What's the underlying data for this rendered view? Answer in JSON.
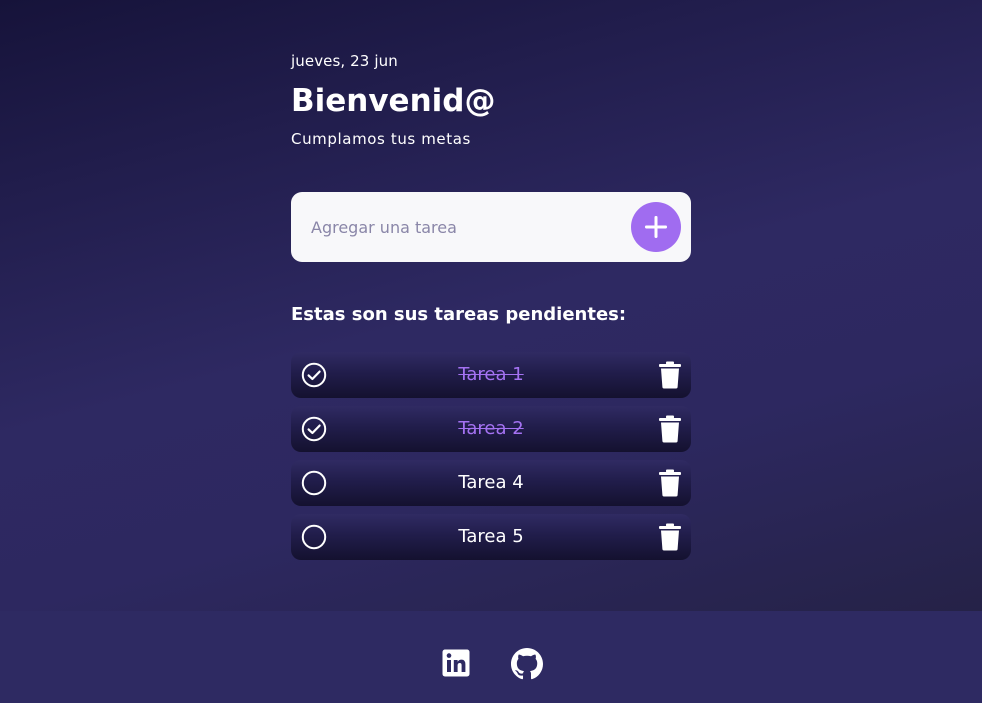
{
  "header": {
    "date": "jueves, 23 jun",
    "title": "Bienvenid@",
    "subtitle": "Cumplamos tus metas"
  },
  "add_task": {
    "placeholder": "Agregar una tarea",
    "value": "",
    "button_icon": "plus-icon",
    "accent_color": "#a06cf0"
  },
  "list": {
    "heading": "Estas son sus tareas pendientes:",
    "tasks": [
      {
        "label": "Tarea 1",
        "completed": true
      },
      {
        "label": "Tarea 2",
        "completed": true
      },
      {
        "label": "Tarea 4",
        "completed": false
      },
      {
        "label": "Tarea 5",
        "completed": false
      }
    ]
  },
  "footer": {
    "links": [
      {
        "icon": "linkedin-icon"
      },
      {
        "icon": "github-icon"
      }
    ]
  },
  "colors": {
    "completed_text": "#a472f2",
    "footer_background": "#2e2a62"
  }
}
